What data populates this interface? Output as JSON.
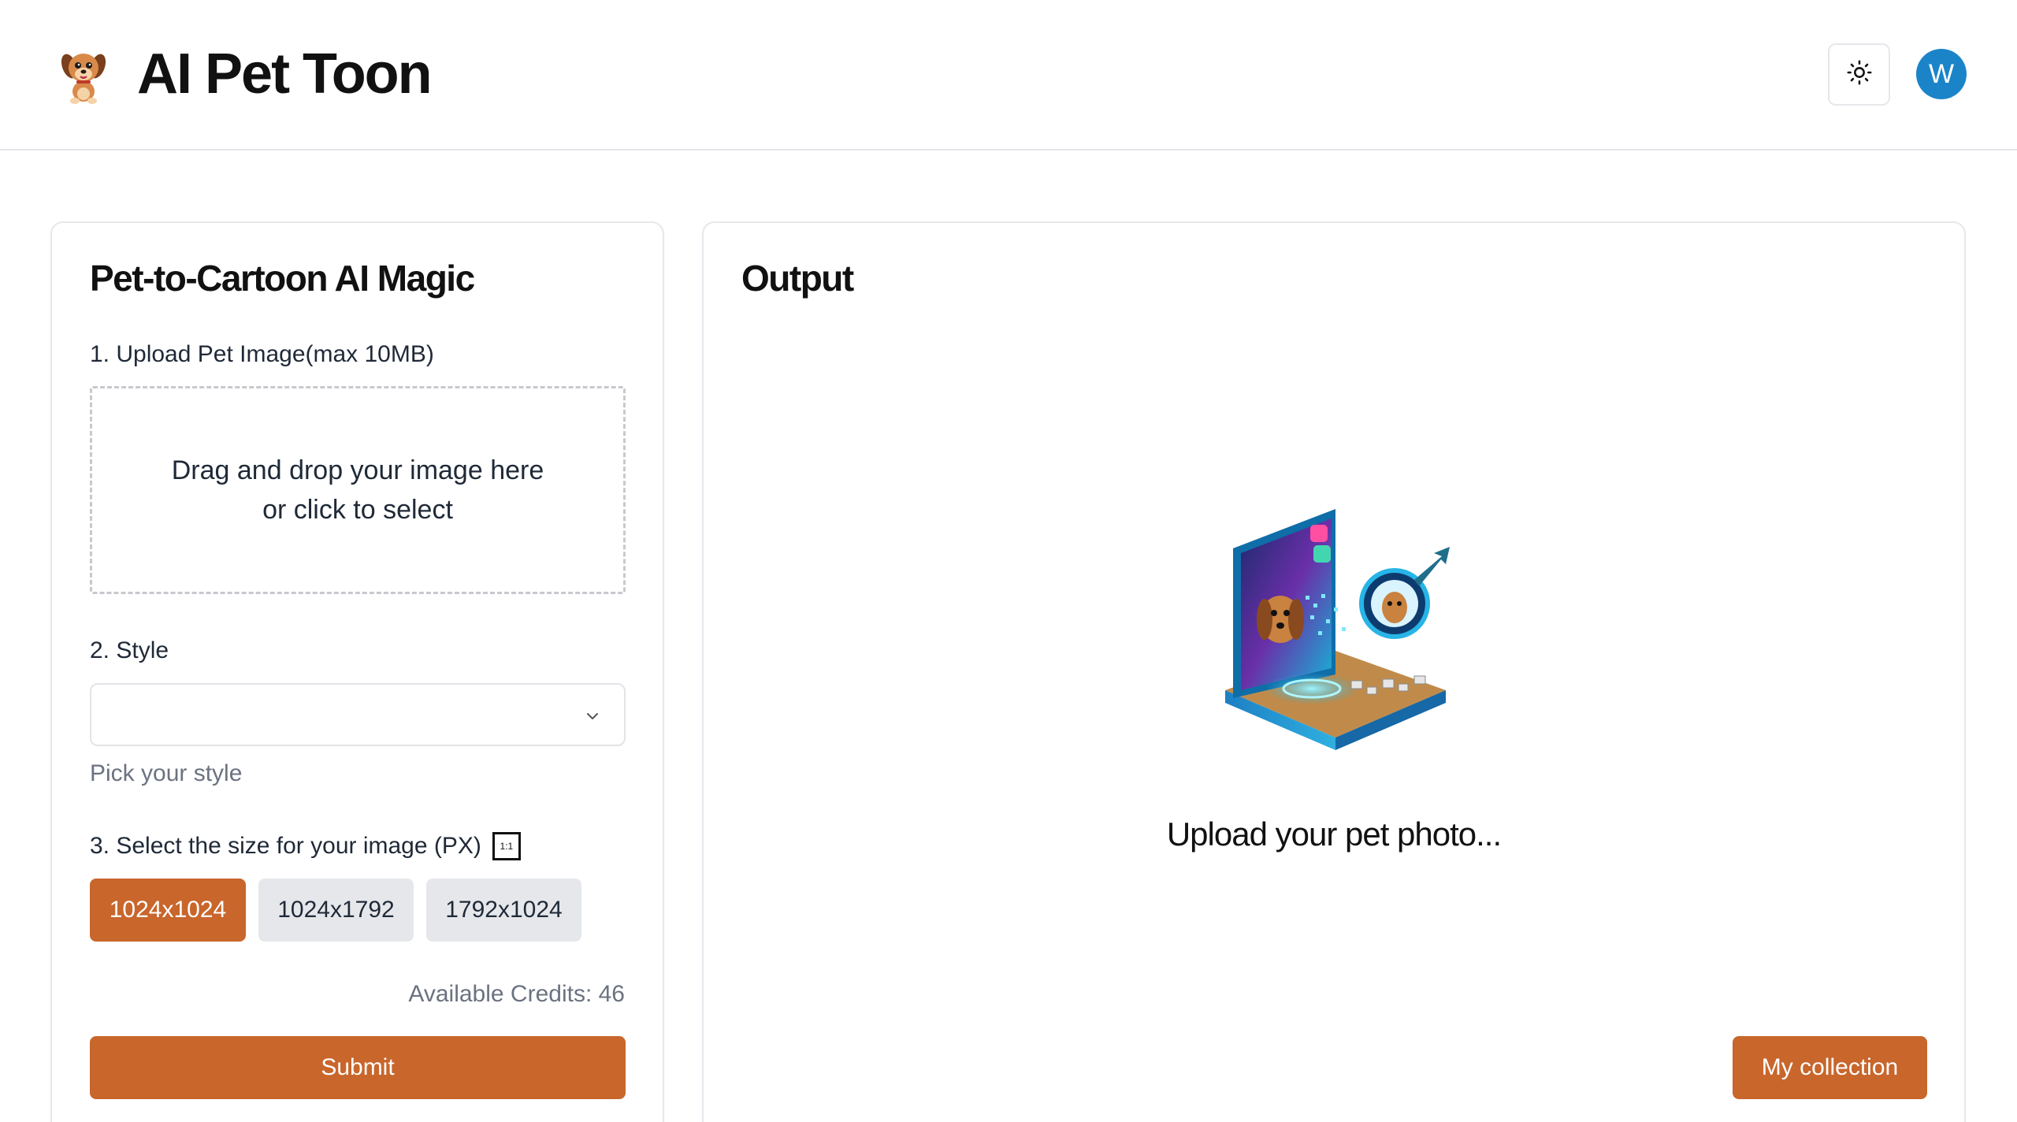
{
  "header": {
    "app_title": "AI Pet Toon",
    "avatar_initial": "W"
  },
  "left_panel": {
    "title": "Pet-to-Cartoon AI Magic",
    "upload": {
      "label": "1. Upload Pet Image(max 10MB)",
      "dropzone_line1": "Drag and drop your image here",
      "dropzone_line2": "or click to select"
    },
    "style": {
      "label": "2. Style",
      "selected_value": "",
      "helper": "Pick your style"
    },
    "size": {
      "label": "3. Select the size for your image (PX)",
      "ratio_badge": "1:1",
      "options": [
        "1024x1024",
        "1024x1792",
        "1792x1024"
      ],
      "selected": "1024x1024"
    },
    "credits": "Available Credits: 46",
    "submit_label": "Submit"
  },
  "right_panel": {
    "title": "Output",
    "placeholder": "Upload your pet photo...",
    "collection_label": "My collection"
  },
  "colors": {
    "accent": "#c8662c",
    "avatar": "#1b84c9",
    "inactive_button": "#e5e7eb"
  }
}
